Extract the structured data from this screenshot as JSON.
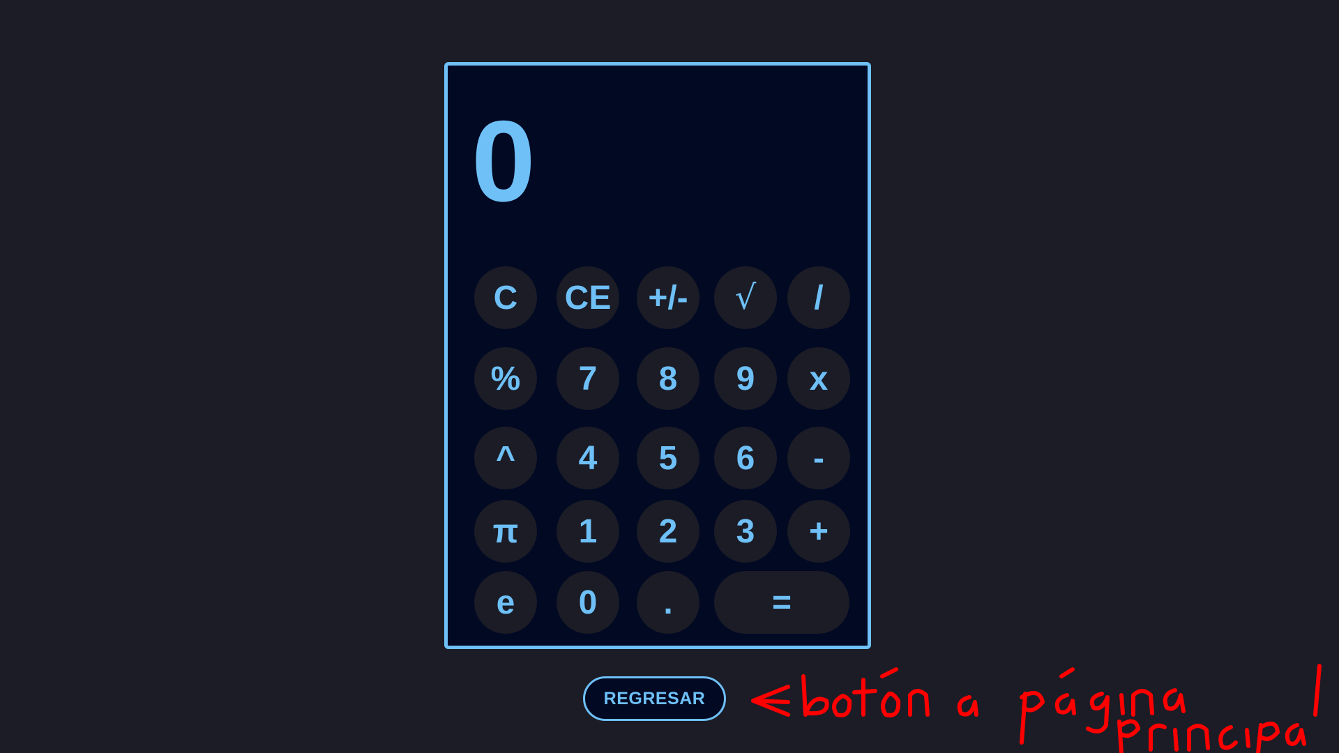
{
  "display": {
    "value": "0"
  },
  "keypad": {
    "row1": [
      "C",
      "CE",
      "+/-",
      "√",
      "/"
    ],
    "row2": [
      "%",
      "7",
      "8",
      "9",
      "x"
    ],
    "row3": [
      "^",
      "4",
      "5",
      "6",
      "-"
    ],
    "row4": [
      "π",
      "1",
      "2",
      "3",
      "+"
    ],
    "row5": [
      "e",
      "0",
      ".",
      "="
    ]
  },
  "back_button": {
    "label": "REGRESAR"
  },
  "annotation": {
    "text": "← botón a página principal"
  },
  "colors": {
    "background": "#1b1c26",
    "calculator_bg": "#020923",
    "accent": "#6ec0f7",
    "button_bg": "#1b1c26",
    "annotation": "#ff0000"
  }
}
